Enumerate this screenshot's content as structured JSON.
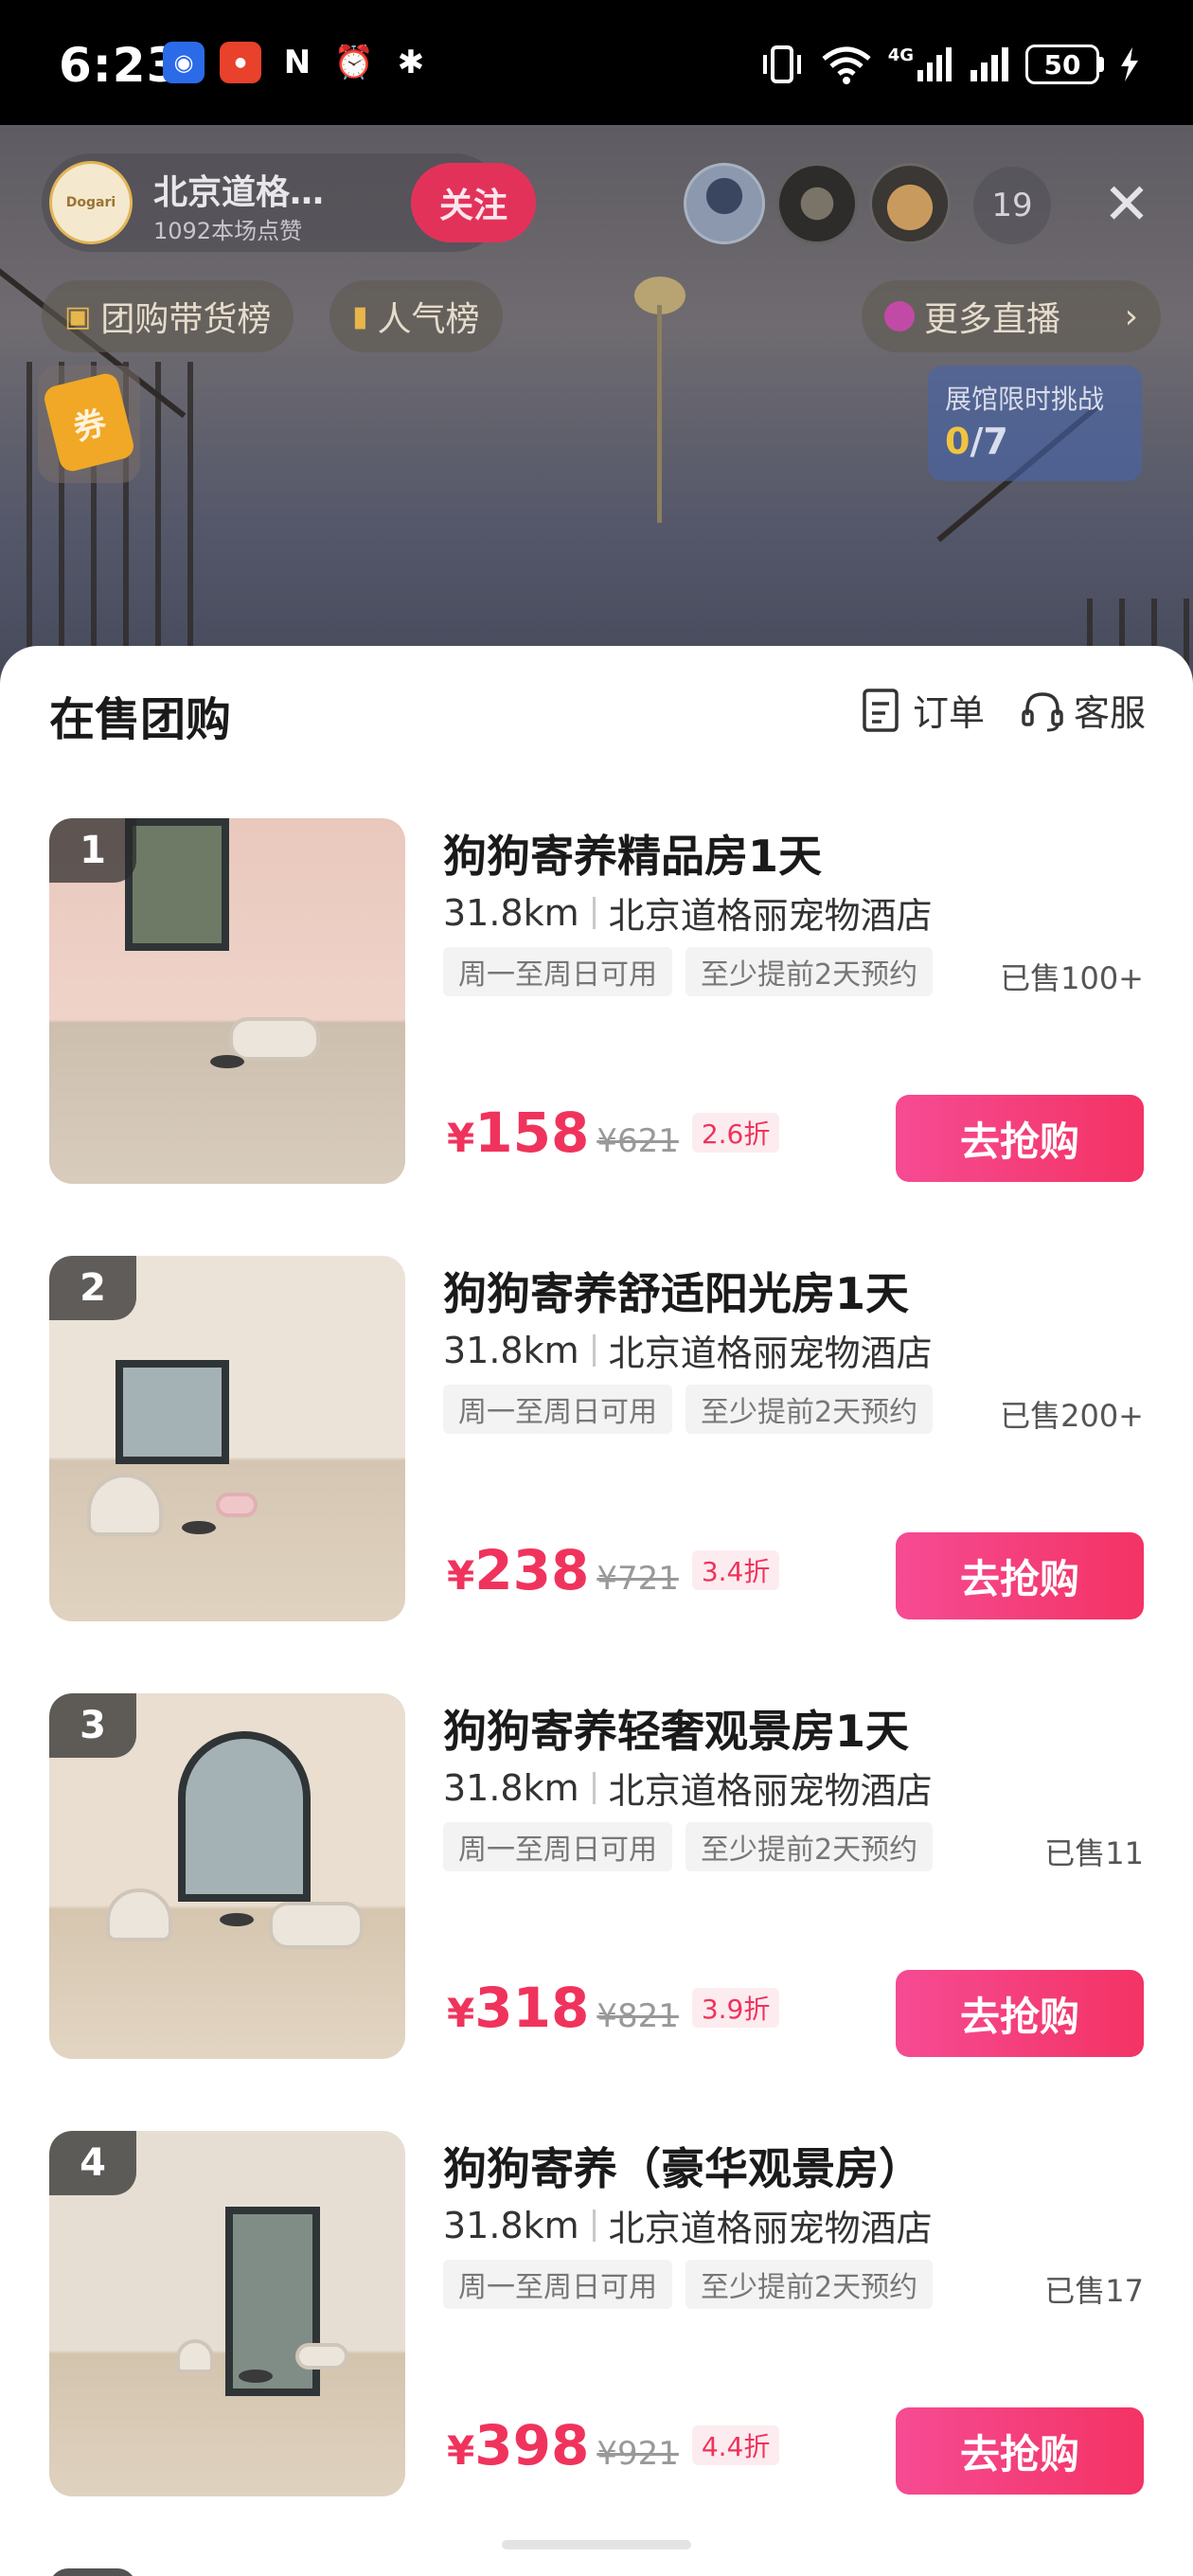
{
  "status_bar": {
    "time": "6:23",
    "battery": "50",
    "network": "4G",
    "icons": [
      "app-blue-icon",
      "app-red-icon",
      "nfc-icon",
      "alarm-icon",
      "bluetooth-icon",
      "vibrate-icon",
      "wifi-icon",
      "signal-4g-icon",
      "signal-icon",
      "battery-icon",
      "charging-icon"
    ]
  },
  "live": {
    "anchor_name": "北京道格…",
    "anchor_likes": "1092本场点赞",
    "avatar_text": "Dogari",
    "follow_label": "关注",
    "viewer_count": "19",
    "chips": {
      "group_buy_rank": "团购带货榜",
      "popularity_rank": "人气榜",
      "more_live": "更多直播"
    },
    "coupon_label": "券",
    "challenge": {
      "title": "展馆限时挑战",
      "done": "0",
      "total": "/7"
    }
  },
  "sheet": {
    "title": "在售团购",
    "orders_label": "订单",
    "service_label": "客服",
    "currency": "¥",
    "buy_label": "去抢购",
    "products": [
      {
        "rank": "1",
        "title": "狗狗寄养精品房1天",
        "distance": "31.8km",
        "store": "北京道格丽宠物酒店",
        "tags": [
          "周一至周日可用",
          "至少提前2天预约"
        ],
        "sold": "已售100+",
        "price": "158",
        "original_price": "¥621",
        "discount": "2.6折"
      },
      {
        "rank": "2",
        "title": "狗狗寄养舒适阳光房1天",
        "distance": "31.8km",
        "store": "北京道格丽宠物酒店",
        "tags": [
          "周一至周日可用",
          "至少提前2天预约"
        ],
        "sold": "已售200+",
        "price": "238",
        "original_price": "¥721",
        "discount": "3.4折"
      },
      {
        "rank": "3",
        "title": "狗狗寄养轻奢观景房1天",
        "distance": "31.8km",
        "store": "北京道格丽宠物酒店",
        "tags": [
          "周一至周日可用",
          "至少提前2天预约"
        ],
        "sold": "已售11",
        "price": "318",
        "original_price": "¥821",
        "discount": "3.9折"
      },
      {
        "rank": "4",
        "title": "狗狗寄养（豪华观景房）",
        "distance": "31.8km",
        "store": "北京道格丽宠物酒店",
        "tags": [
          "周一至周日可用",
          "至少提前2天预约"
        ],
        "sold": "已售17",
        "price": "398",
        "original_price": "¥921",
        "discount": "4.4折"
      }
    ]
  },
  "colors": {
    "accent": "#f0335c",
    "buy_gradient_start": "#f64b93",
    "buy_gradient_end": "#f33364",
    "follow": "#e3325a"
  }
}
